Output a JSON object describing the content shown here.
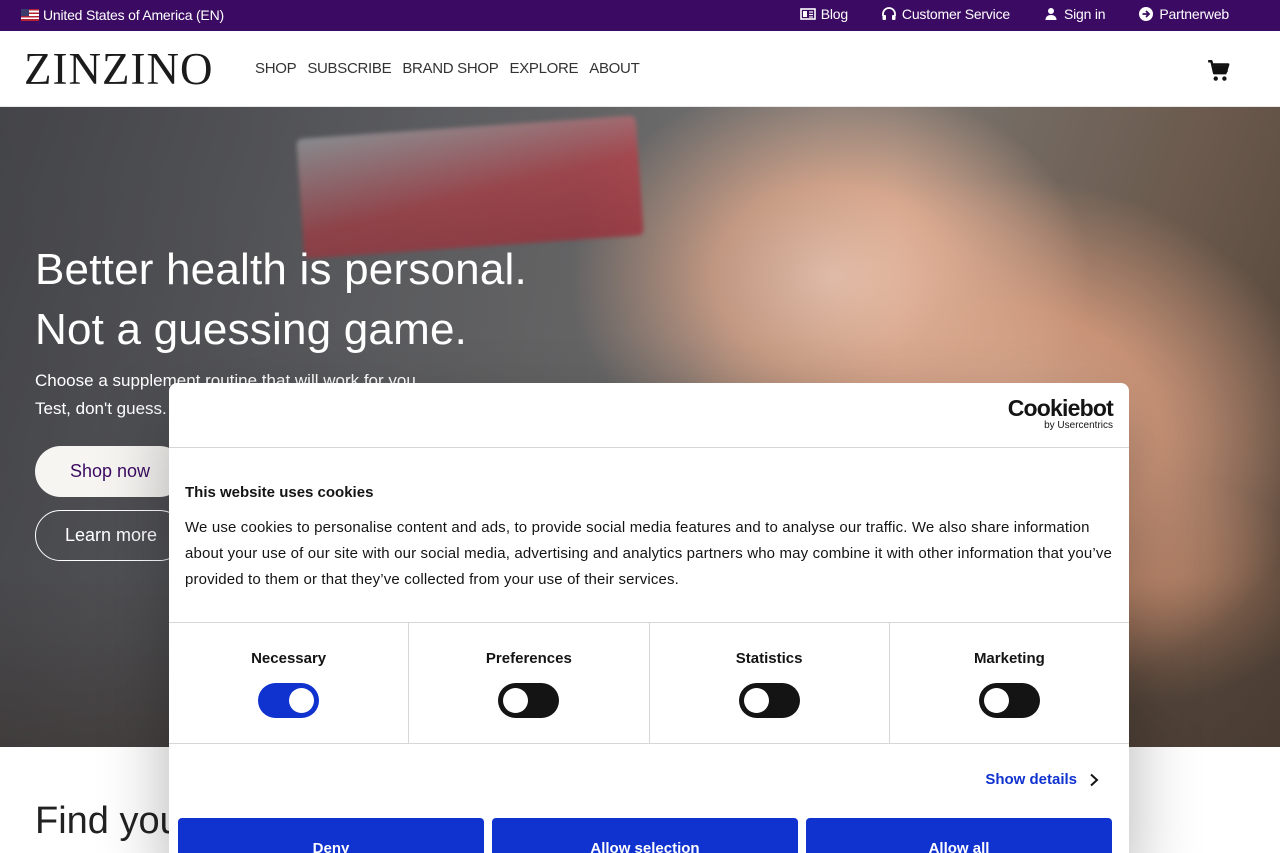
{
  "topbar": {
    "locale": "United States of America (EN)",
    "links": [
      {
        "label": "Blog",
        "icon": "newspaper-icon"
      },
      {
        "label": "Customer Service",
        "icon": "headset-icon"
      },
      {
        "label": "Sign in",
        "icon": "user-icon"
      },
      {
        "label": "Partnerweb",
        "icon": "arrow-circle-icon"
      }
    ]
  },
  "header": {
    "logo": "ZINZINO",
    "nav": [
      "SHOP",
      "SUBSCRIBE",
      "BRAND SHOP",
      "EXPLORE",
      "ABOUT"
    ]
  },
  "hero": {
    "title_line1": "Better health is personal.",
    "title_line2": "Not a guessing game.",
    "sub_line1": "Choose a supplement routine that will work for you.",
    "sub_line2": "Test, don't guess.",
    "shop_label": "Shop now",
    "learn_label": "Learn more"
  },
  "section": {
    "heading": "Find your"
  },
  "cookie": {
    "brand": "Cookiebot",
    "brand_sub": "by Usercentrics",
    "title": "This website uses cookies",
    "text": "We use cookies to personalise content and ads, to provide social media features and to analyse our traffic. We also share information about your use of our site with our social media, advertising and analytics partners who may combine it with other information that you’ve provided to them or that they’ve collected from your use of their services.",
    "categories": [
      {
        "label": "Necessary",
        "enabled": true
      },
      {
        "label": "Preferences",
        "enabled": false
      },
      {
        "label": "Statistics",
        "enabled": false
      },
      {
        "label": "Marketing",
        "enabled": false
      }
    ],
    "show_details": "Show details",
    "deny": "Deny",
    "allow_selection": "Allow selection",
    "allow_all": "Allow all",
    "accent_color": "#1032cf"
  },
  "colors": {
    "topbar_bg": "#3b0b63"
  }
}
